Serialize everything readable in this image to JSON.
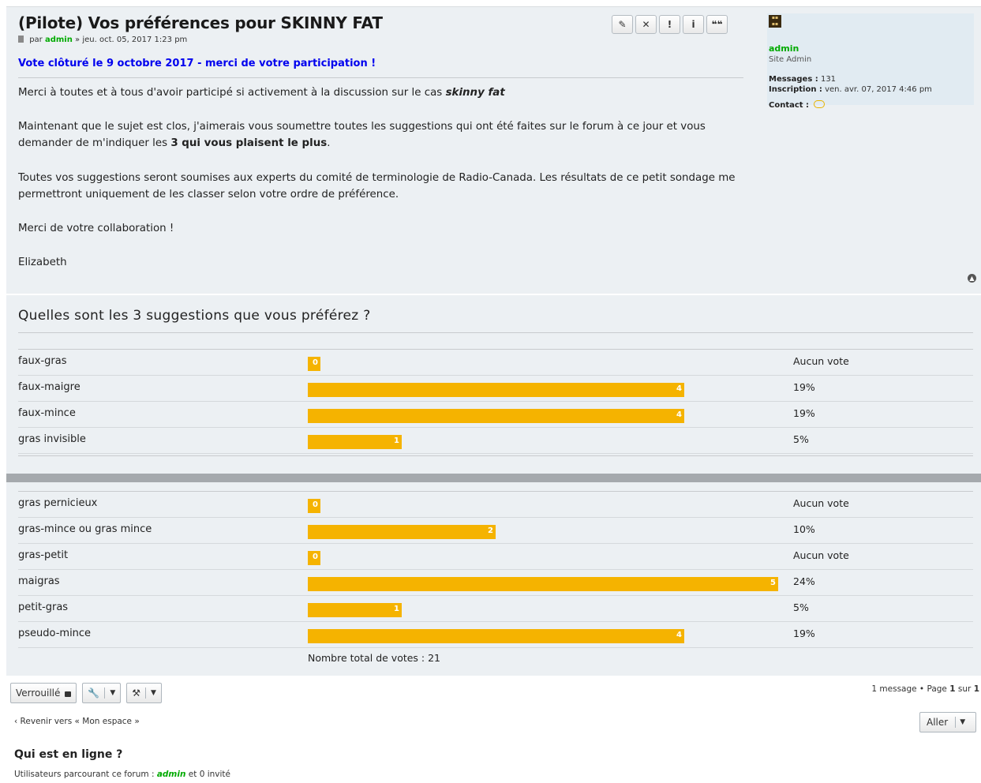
{
  "post": {
    "title": "(Pilote) Vos préférences pour SKINNY FAT",
    "meta_prefix": "par",
    "author": "admin",
    "meta_date": "» jeu. oct. 05, 2017 1:23 pm",
    "closed_note": "Vote clôturé le 9 octobre 2017 - merci de votre participation !",
    "tools": [
      "✎",
      "✕",
      "!",
      "i",
      "❝❝"
    ],
    "p1_text": "Merci à toutes et à tous d'avoir participé si activement à la discussion sur le cas",
    "p1_em": "skinny fat",
    "p2_text": "Maintenant que le sujet est clos, j'aimerais vous soumettre toutes les suggestions qui ont été faites sur le forum à ce jour et vous demander de m'indiquer les",
    "p2_bold": "3 qui vous plaisent le plus",
    "p3": "Toutes vos suggestions seront soumises aux experts du comité de terminologie de Radio-Canada. Les résultats de ce petit sondage me permettront uniquement de les classer selon votre ordre de préférence.",
    "p4": "Merci de votre collaboration !",
    "p5": "Elizabeth"
  },
  "profile": {
    "name": "admin",
    "rank": "Site Admin",
    "messages_label": "Messages :",
    "messages_value": "131",
    "inscription_label": "Inscription :",
    "inscription_value": "ven. avr. 07, 2017 4:46 pm",
    "contact_label": "Contact :"
  },
  "poll": {
    "question": "Quelles sont les 3 suggestions que vous préférez ?",
    "max_votes": 5,
    "options_group1": [
      {
        "label": "faux-gras",
        "votes": 0,
        "pct": "Aucun vote"
      },
      {
        "label": "faux-maigre",
        "votes": 4,
        "pct": "19%"
      },
      {
        "label": "faux-mince",
        "votes": 4,
        "pct": "19%"
      },
      {
        "label": "gras invisible",
        "votes": 1,
        "pct": "5%"
      }
    ],
    "options_group2": [
      {
        "label": "gras pernicieux",
        "votes": 0,
        "pct": "Aucun vote"
      },
      {
        "label": "gras-mince ou gras mince",
        "votes": 2,
        "pct": "10%"
      },
      {
        "label": "gras-petit",
        "votes": 0,
        "pct": "Aucun vote"
      },
      {
        "label": "maigras",
        "votes": 5,
        "pct": "24%"
      },
      {
        "label": "petit-gras",
        "votes": 1,
        "pct": "5%"
      },
      {
        "label": "pseudo-mince",
        "votes": 4,
        "pct": "19%"
      }
    ],
    "total": "Nombre total de votes : 21"
  },
  "footer": {
    "locked_label": "Verrouillé",
    "pagination_prefix": "1 message • Page",
    "page_current": "1",
    "page_sep": "sur",
    "page_total": "1",
    "back_link": "‹ Revenir vers « Mon espace »",
    "jump_label": "Aller",
    "online_heading": "Qui est en ligne ?",
    "online_prefix": "Utilisateurs parcourant ce forum :",
    "online_user": "admin",
    "online_suffix": "et 0 invité"
  },
  "colors": {
    "bar": "#f5b300",
    "closed_note": "#0000ee",
    "username": "#00aa00",
    "panel": "#ecf0f3"
  }
}
